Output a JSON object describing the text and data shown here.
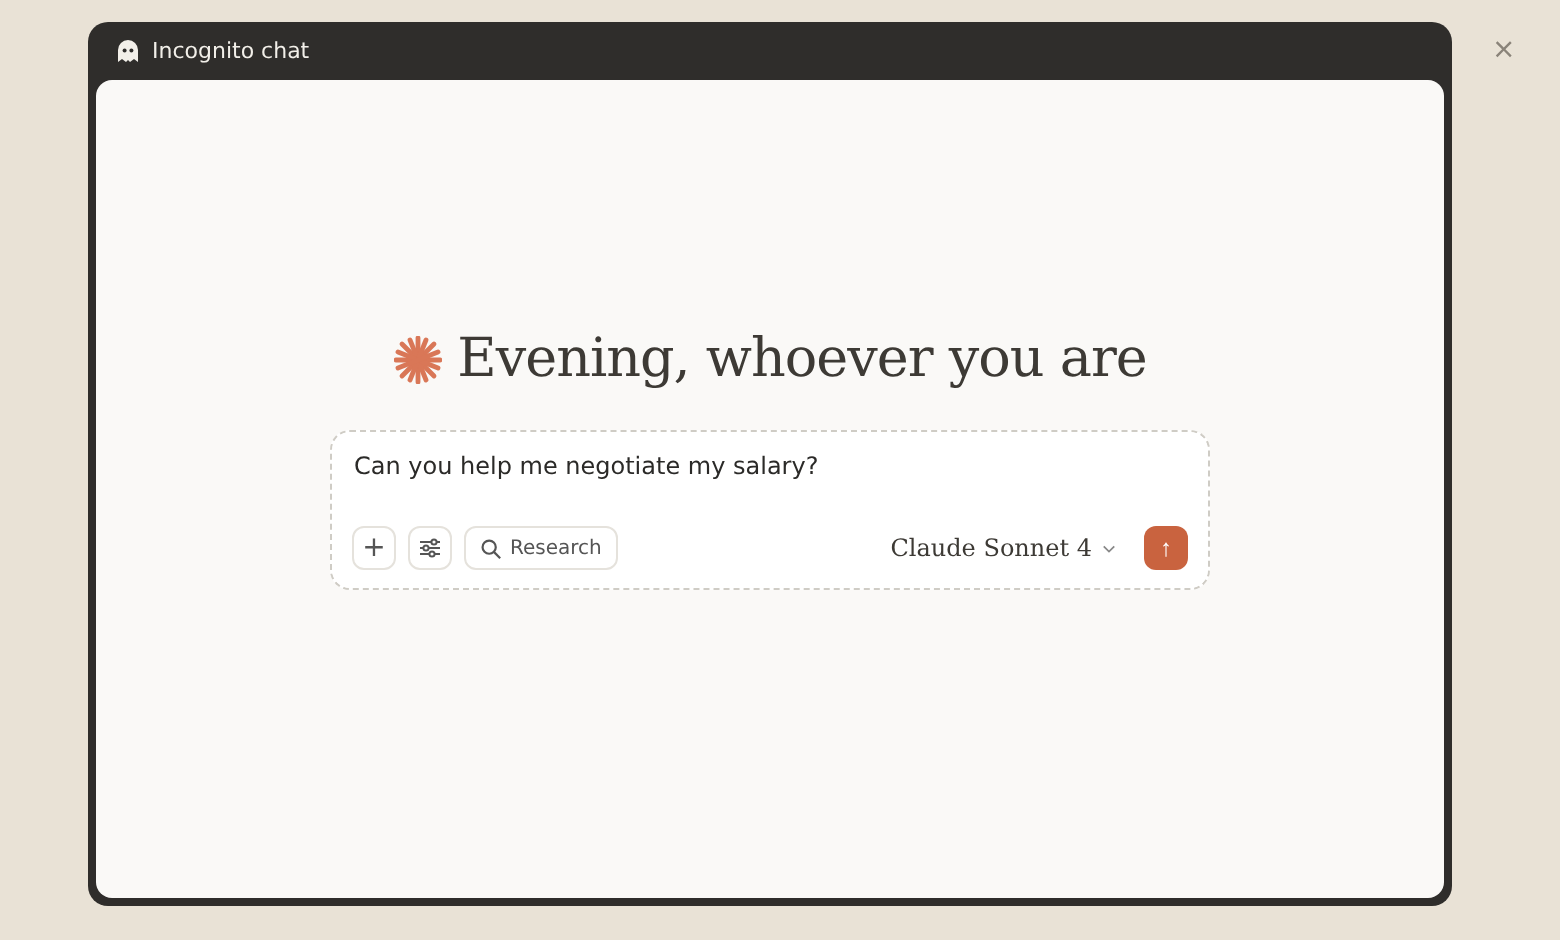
{
  "window": {
    "title": "Incognito chat",
    "close": "×"
  },
  "greeting": "Evening, whoever you are",
  "composer": {
    "value": "Can you help me negotiate my salary?",
    "add": "+",
    "research": "Research",
    "model": "Claude Sonnet 4",
    "send": "↑"
  }
}
